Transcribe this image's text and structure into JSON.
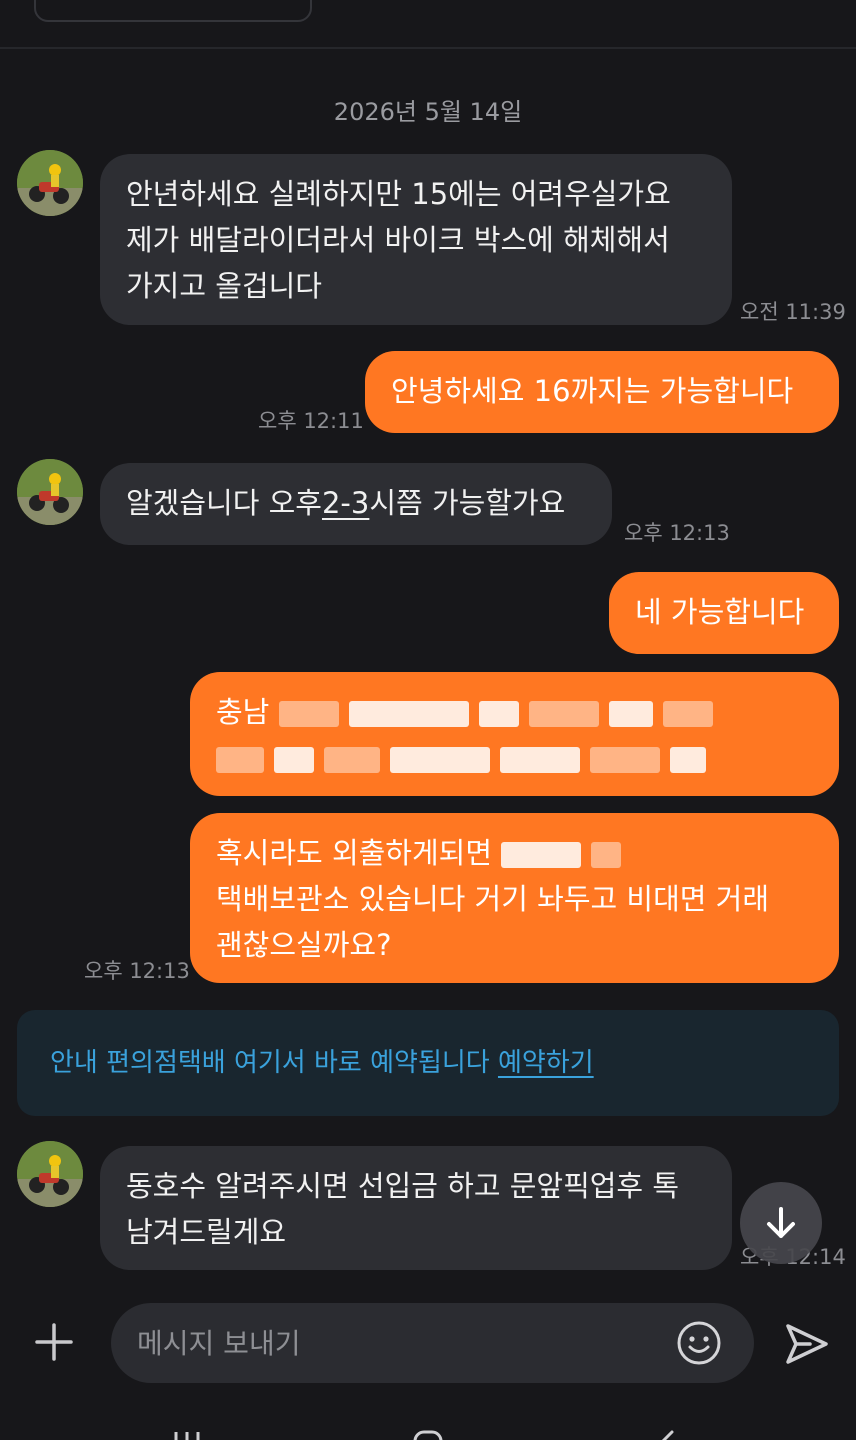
{
  "date_separator": "2026년 5월 14일",
  "messages": [
    {
      "lines": [
        "안년하세요 실례하지만 15에는 어려우실가요",
        "제가 배달라이더라서 바이크 박스에 해체해서",
        "가지고 올겁니다"
      ],
      "time": "오전 11:39"
    },
    {
      "text": "안녕하세요 16까지는 가능합니다",
      "time": "오후 12:11"
    },
    {
      "text_pre": "알겠습니다 오후",
      "text_underlined": "2-3",
      "text_post": "시쯤 가능할가요",
      "time": "오후 12:13"
    },
    {
      "text": "네 가능합니다"
    },
    {
      "line1_visible": "충남"
    },
    {
      "line1": "혹시라도 외출하게되면",
      "line2": "택배보관소 있습니다 거기 놔두고 비대면 거래",
      "line3": "괜찮으실까요?",
      "time": "오후 12:13"
    },
    {
      "lines": [
        "동호수 알려주시면 선입금 하고 문앞픽업후 톡",
        "남겨드릴게요"
      ],
      "time": "오후 12:14"
    }
  ],
  "notice": {
    "label": "안내 편의점택배 여기서 바로 예약됩니다",
    "link": "예약하기",
    "color": "#3aa2dc"
  },
  "composer": {
    "placeholder": "메시지 보내기"
  },
  "icons": {
    "add": "plus-icon",
    "emoji": "smiley-icon",
    "send": "send-icon",
    "scroll": "arrow-down-icon"
  },
  "colors": {
    "background": "#17171a",
    "sent_bubble": "#ff7722",
    "received_bubble": "#2d2e33",
    "time": "#8c8d92"
  }
}
